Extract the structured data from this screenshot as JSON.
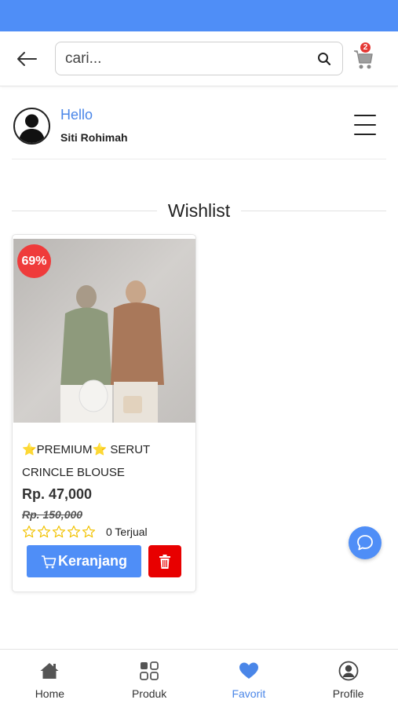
{
  "header": {
    "search_placeholder": "cari...",
    "cart_count": "2",
    "accent_color": "#4f8ef7"
  },
  "user": {
    "greeting": "Hello",
    "name": "Siti Rohimah"
  },
  "section": {
    "title": "Wishlist"
  },
  "wishlist": [
    {
      "discount": "69%",
      "name": "⭐PREMIUM⭐ SERUT CRINCLE BLOUSE",
      "price": "Rp. 47,000",
      "old_price": "Rp. 150,000",
      "rating": 0,
      "sold": "0 Terjual",
      "add_to_cart_label": "Keranjang"
    }
  ],
  "bottom_nav": {
    "items": [
      {
        "label": "Home",
        "icon": "home-icon",
        "active": false
      },
      {
        "label": "Produk",
        "icon": "grid-icon",
        "active": false
      },
      {
        "label": "Favorit",
        "icon": "heart-icon",
        "active": true
      },
      {
        "label": "Profile",
        "icon": "user-circle-icon",
        "active": false
      }
    ]
  }
}
